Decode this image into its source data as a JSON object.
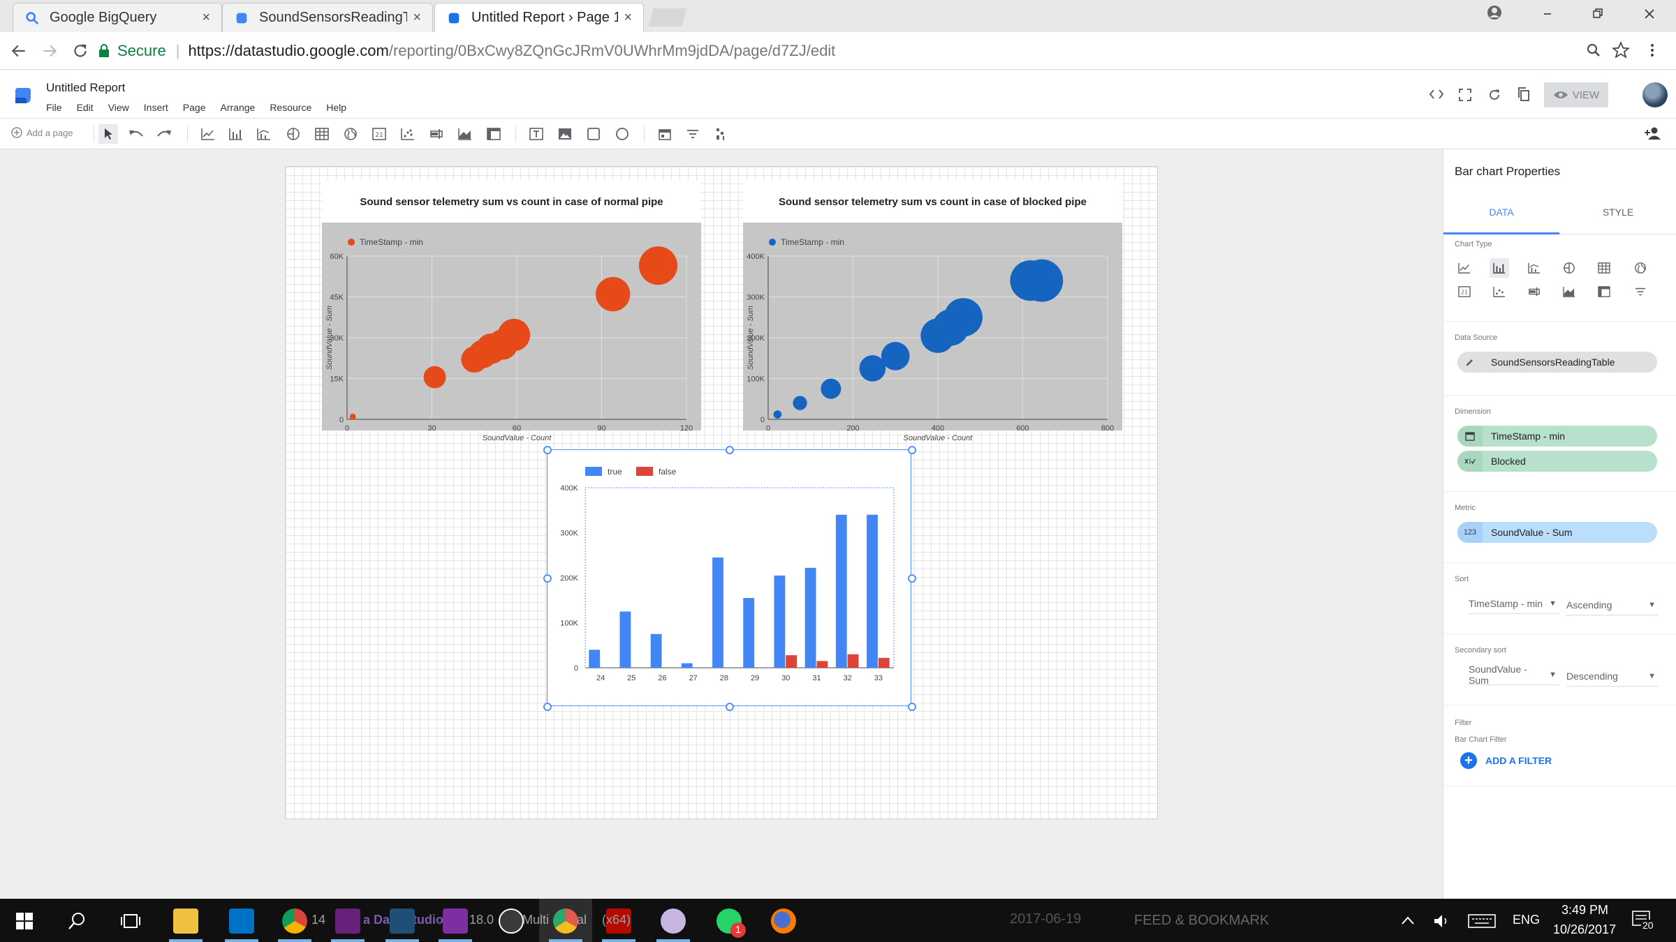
{
  "tabs": [
    {
      "title": "Google BigQuery",
      "close": "×"
    },
    {
      "title": "SoundSensorsReadingTa",
      "close": "×"
    },
    {
      "title": "Untitled Report › Page 1",
      "close": "×"
    }
  ],
  "address": {
    "secure_label": "Secure",
    "url_host": "https://datastudio.google.com",
    "url_path": "/reporting/0BxCwy8ZQnGcJRmV0UWhrMm9jdDA/page/d7ZJ/edit"
  },
  "report": {
    "title": "Untitled Report",
    "menu": [
      "File",
      "Edit",
      "View",
      "Insert",
      "Page",
      "Arrange",
      "Resource",
      "Help"
    ],
    "view_button": "VIEW"
  },
  "toolbar": {
    "add_page": "Add a page"
  },
  "chart_data": [
    {
      "type": "scatter",
      "title": "Sound sensor telemetry sum vs count in case of normal pipe",
      "legend": "TimeStamp - min",
      "color": "#e64a19",
      "xlabel": "SoundValue - Count",
      "ylabel": "SoundValue - Sum",
      "xlim": [
        0,
        120
      ],
      "ylim": [
        0,
        60000
      ],
      "xticks": [
        "0",
        "30",
        "60",
        "90",
        "120"
      ],
      "yticks": [
        "0",
        "15K",
        "30K",
        "45K",
        "60K"
      ],
      "points": [
        {
          "x": 2,
          "y": 1000,
          "r": 3
        },
        {
          "x": 31,
          "y": 15500,
          "r": 11
        },
        {
          "x": 45,
          "y": 22000,
          "r": 13
        },
        {
          "x": 48,
          "y": 24000,
          "r": 14
        },
        {
          "x": 51,
          "y": 26000,
          "r": 15
        },
        {
          "x": 55,
          "y": 27500,
          "r": 15
        },
        {
          "x": 59,
          "y": 31000,
          "r": 16
        },
        {
          "x": 94,
          "y": 46000,
          "r": 17
        },
        {
          "x": 110,
          "y": 56500,
          "r": 19
        }
      ]
    },
    {
      "type": "scatter",
      "title": "Sound sensor telemetry sum vs count in case of blocked pipe",
      "legend": "TimeStamp - min",
      "color": "#1565c0",
      "xlabel": "SoundValue - Count",
      "ylabel": "SoundValue - Sum",
      "xlim": [
        0,
        800
      ],
      "ylim": [
        0,
        400000
      ],
      "xticks": [
        "0",
        "200",
        "400",
        "600",
        "800"
      ],
      "yticks": [
        "0",
        "100K",
        "200K",
        "300K",
        "400K"
      ],
      "points": [
        {
          "x": 22,
          "y": 12000,
          "r": 4
        },
        {
          "x": 75,
          "y": 40000,
          "r": 7
        },
        {
          "x": 148,
          "y": 75000,
          "r": 10
        },
        {
          "x": 246,
          "y": 125000,
          "r": 13
        },
        {
          "x": 300,
          "y": 155000,
          "r": 14
        },
        {
          "x": 400,
          "y": 205000,
          "r": 17
        },
        {
          "x": 430,
          "y": 225000,
          "r": 18
        },
        {
          "x": 460,
          "y": 250000,
          "r": 19
        },
        {
          "x": 618,
          "y": 340000,
          "r": 20
        },
        {
          "x": 645,
          "y": 340000,
          "r": 21
        }
      ]
    },
    {
      "type": "bar",
      "categories": [
        "24",
        "25",
        "26",
        "27",
        "28",
        "29",
        "30",
        "31",
        "32",
        "33"
      ],
      "series": [
        {
          "name": "true",
          "color": "#4285f4",
          "values": [
            40000,
            125000,
            75000,
            10000,
            245000,
            155000,
            205000,
            222000,
            340000,
            340000
          ]
        },
        {
          "name": "false",
          "color": "#db4437",
          "values": [
            0,
            0,
            0,
            0,
            0,
            0,
            28000,
            15000,
            30000,
            22000
          ]
        }
      ],
      "ylim": [
        0,
        400000
      ],
      "yticks": [
        "0",
        "100K",
        "200K",
        "300K",
        "400K"
      ],
      "legend_position": "top-left"
    }
  ],
  "panel": {
    "title": "Bar chart Properties",
    "tab_data": "DATA",
    "tab_style": "STYLE",
    "chart_type_label": "Chart Type",
    "data_source_label": "Data Source",
    "data_source": "SoundSensorsReadingTable",
    "dimension_label": "Dimension",
    "dimensions": [
      "TimeStamp - min",
      "Blocked"
    ],
    "metric_label": "Metric",
    "metric": "SoundValue - Sum",
    "metric_icon": "123",
    "sort_label": "Sort",
    "sort_field": "TimeStamp - min",
    "sort_order": "Ascending",
    "secondary_sort_label": "Secondary sort",
    "secondary_sort_field": "SoundValue - Sum",
    "secondary_sort_order": "Descending",
    "filter_label": "Filter",
    "bar_chart_filter_label": "Bar Chart Filter",
    "add_filter": "ADD A FILTER"
  },
  "taskbar": {
    "ghost_texts": [
      "14",
      "a Data Studio",
      "18.0",
      "Multi",
      "al",
      "(x64)"
    ],
    "bg_text_date": "2017-06-19",
    "bg_text_feed": "FEED & BOOKMARK",
    "lang": "ENG",
    "time": "3:49 PM",
    "date": "10/26/2017",
    "notifications": "20",
    "whatsapp_badge": "1"
  }
}
